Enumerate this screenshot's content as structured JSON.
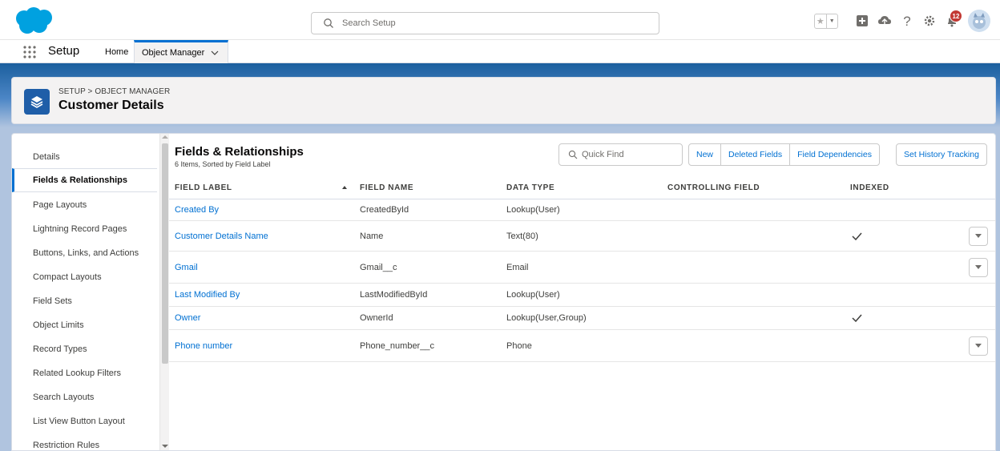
{
  "global_header": {
    "search_placeholder": "Search Setup",
    "notification_count": "12"
  },
  "context_bar": {
    "app_name": "Setup",
    "tabs": [
      {
        "label": "Home"
      },
      {
        "label": "Object Manager"
      }
    ]
  },
  "page_header": {
    "breadcrumb": "SETUP > OBJECT MANAGER",
    "title": "Customer Details"
  },
  "sidebar": {
    "items": [
      {
        "label": "Details"
      },
      {
        "label": "Fields & Relationships"
      },
      {
        "label": "Page Layouts"
      },
      {
        "label": "Lightning Record Pages"
      },
      {
        "label": "Buttons, Links, and Actions"
      },
      {
        "label": "Compact Layouts"
      },
      {
        "label": "Field Sets"
      },
      {
        "label": "Object Limits"
      },
      {
        "label": "Record Types"
      },
      {
        "label": "Related Lookup Filters"
      },
      {
        "label": "Search Layouts"
      },
      {
        "label": "List View Button Layout"
      },
      {
        "label": "Restriction Rules"
      }
    ]
  },
  "section": {
    "title": "Fields & Relationships",
    "subtitle": "6 Items, Sorted by Field Label",
    "quick_find_placeholder": "Quick Find",
    "buttons": {
      "new": "New",
      "deleted_fields": "Deleted Fields",
      "field_dependencies": "Field Dependencies",
      "set_history_tracking": "Set History Tracking"
    }
  },
  "table": {
    "headers": {
      "field_label": "FIELD LABEL",
      "field_name": "FIELD NAME",
      "data_type": "DATA TYPE",
      "controlling_field": "CONTROLLING FIELD",
      "indexed": "INDEXED"
    },
    "rows": [
      {
        "field_label": "Created By",
        "field_name": "CreatedById",
        "data_type": "Lookup(User)",
        "indexed": false
      },
      {
        "field_label": "Customer Details Name",
        "field_name": "Name",
        "data_type": "Text(80)",
        "indexed": true
      },
      {
        "field_label": "Gmail",
        "field_name": "Gmail__c",
        "data_type": "Email",
        "indexed": false
      },
      {
        "field_label": "Last Modified By",
        "field_name": "LastModifiedById",
        "data_type": "Lookup(User)",
        "indexed": false
      },
      {
        "field_label": "Owner",
        "field_name": "OwnerId",
        "data_type": "Lookup(User,Group)",
        "indexed": true
      },
      {
        "field_label": "Phone number",
        "field_name": "Phone_number__c",
        "data_type": "Phone",
        "indexed": false
      }
    ]
  },
  "colors": {
    "brand_blue": "#0070d2",
    "salesforce_cloud": "#00a1e0",
    "notification_red": "#c23934"
  }
}
